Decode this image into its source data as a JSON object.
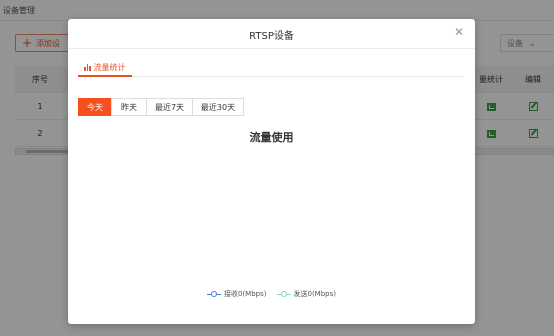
{
  "background": {
    "page_title": "设备管理",
    "add_button": "添加设",
    "filter_label": "设备",
    "table": {
      "headers": {
        "index": "序号",
        "traffic": "量统计",
        "edit": "编辑"
      },
      "rows": [
        {
          "index": "1"
        },
        {
          "index": "2"
        }
      ]
    }
  },
  "modal": {
    "title": "RTSP设备",
    "close_icon": "close-icon",
    "tabs": [
      {
        "label": "流量统计",
        "icon": "bar-chart-icon"
      }
    ],
    "ranges": [
      {
        "label": "今天",
        "active": true
      },
      {
        "label": "昨天",
        "active": false
      },
      {
        "label": "最近7天",
        "active": false
      },
      {
        "label": "最近30天",
        "active": false
      }
    ],
    "chart_title": "流量使用",
    "legend": [
      {
        "label": "接收0(Mbps)",
        "color": "#4a7fd4"
      },
      {
        "label": "发送0(Mbps)",
        "color": "#7fd8c3"
      }
    ]
  },
  "colors": {
    "accent": "#f4511e",
    "success": "#3aa346"
  }
}
